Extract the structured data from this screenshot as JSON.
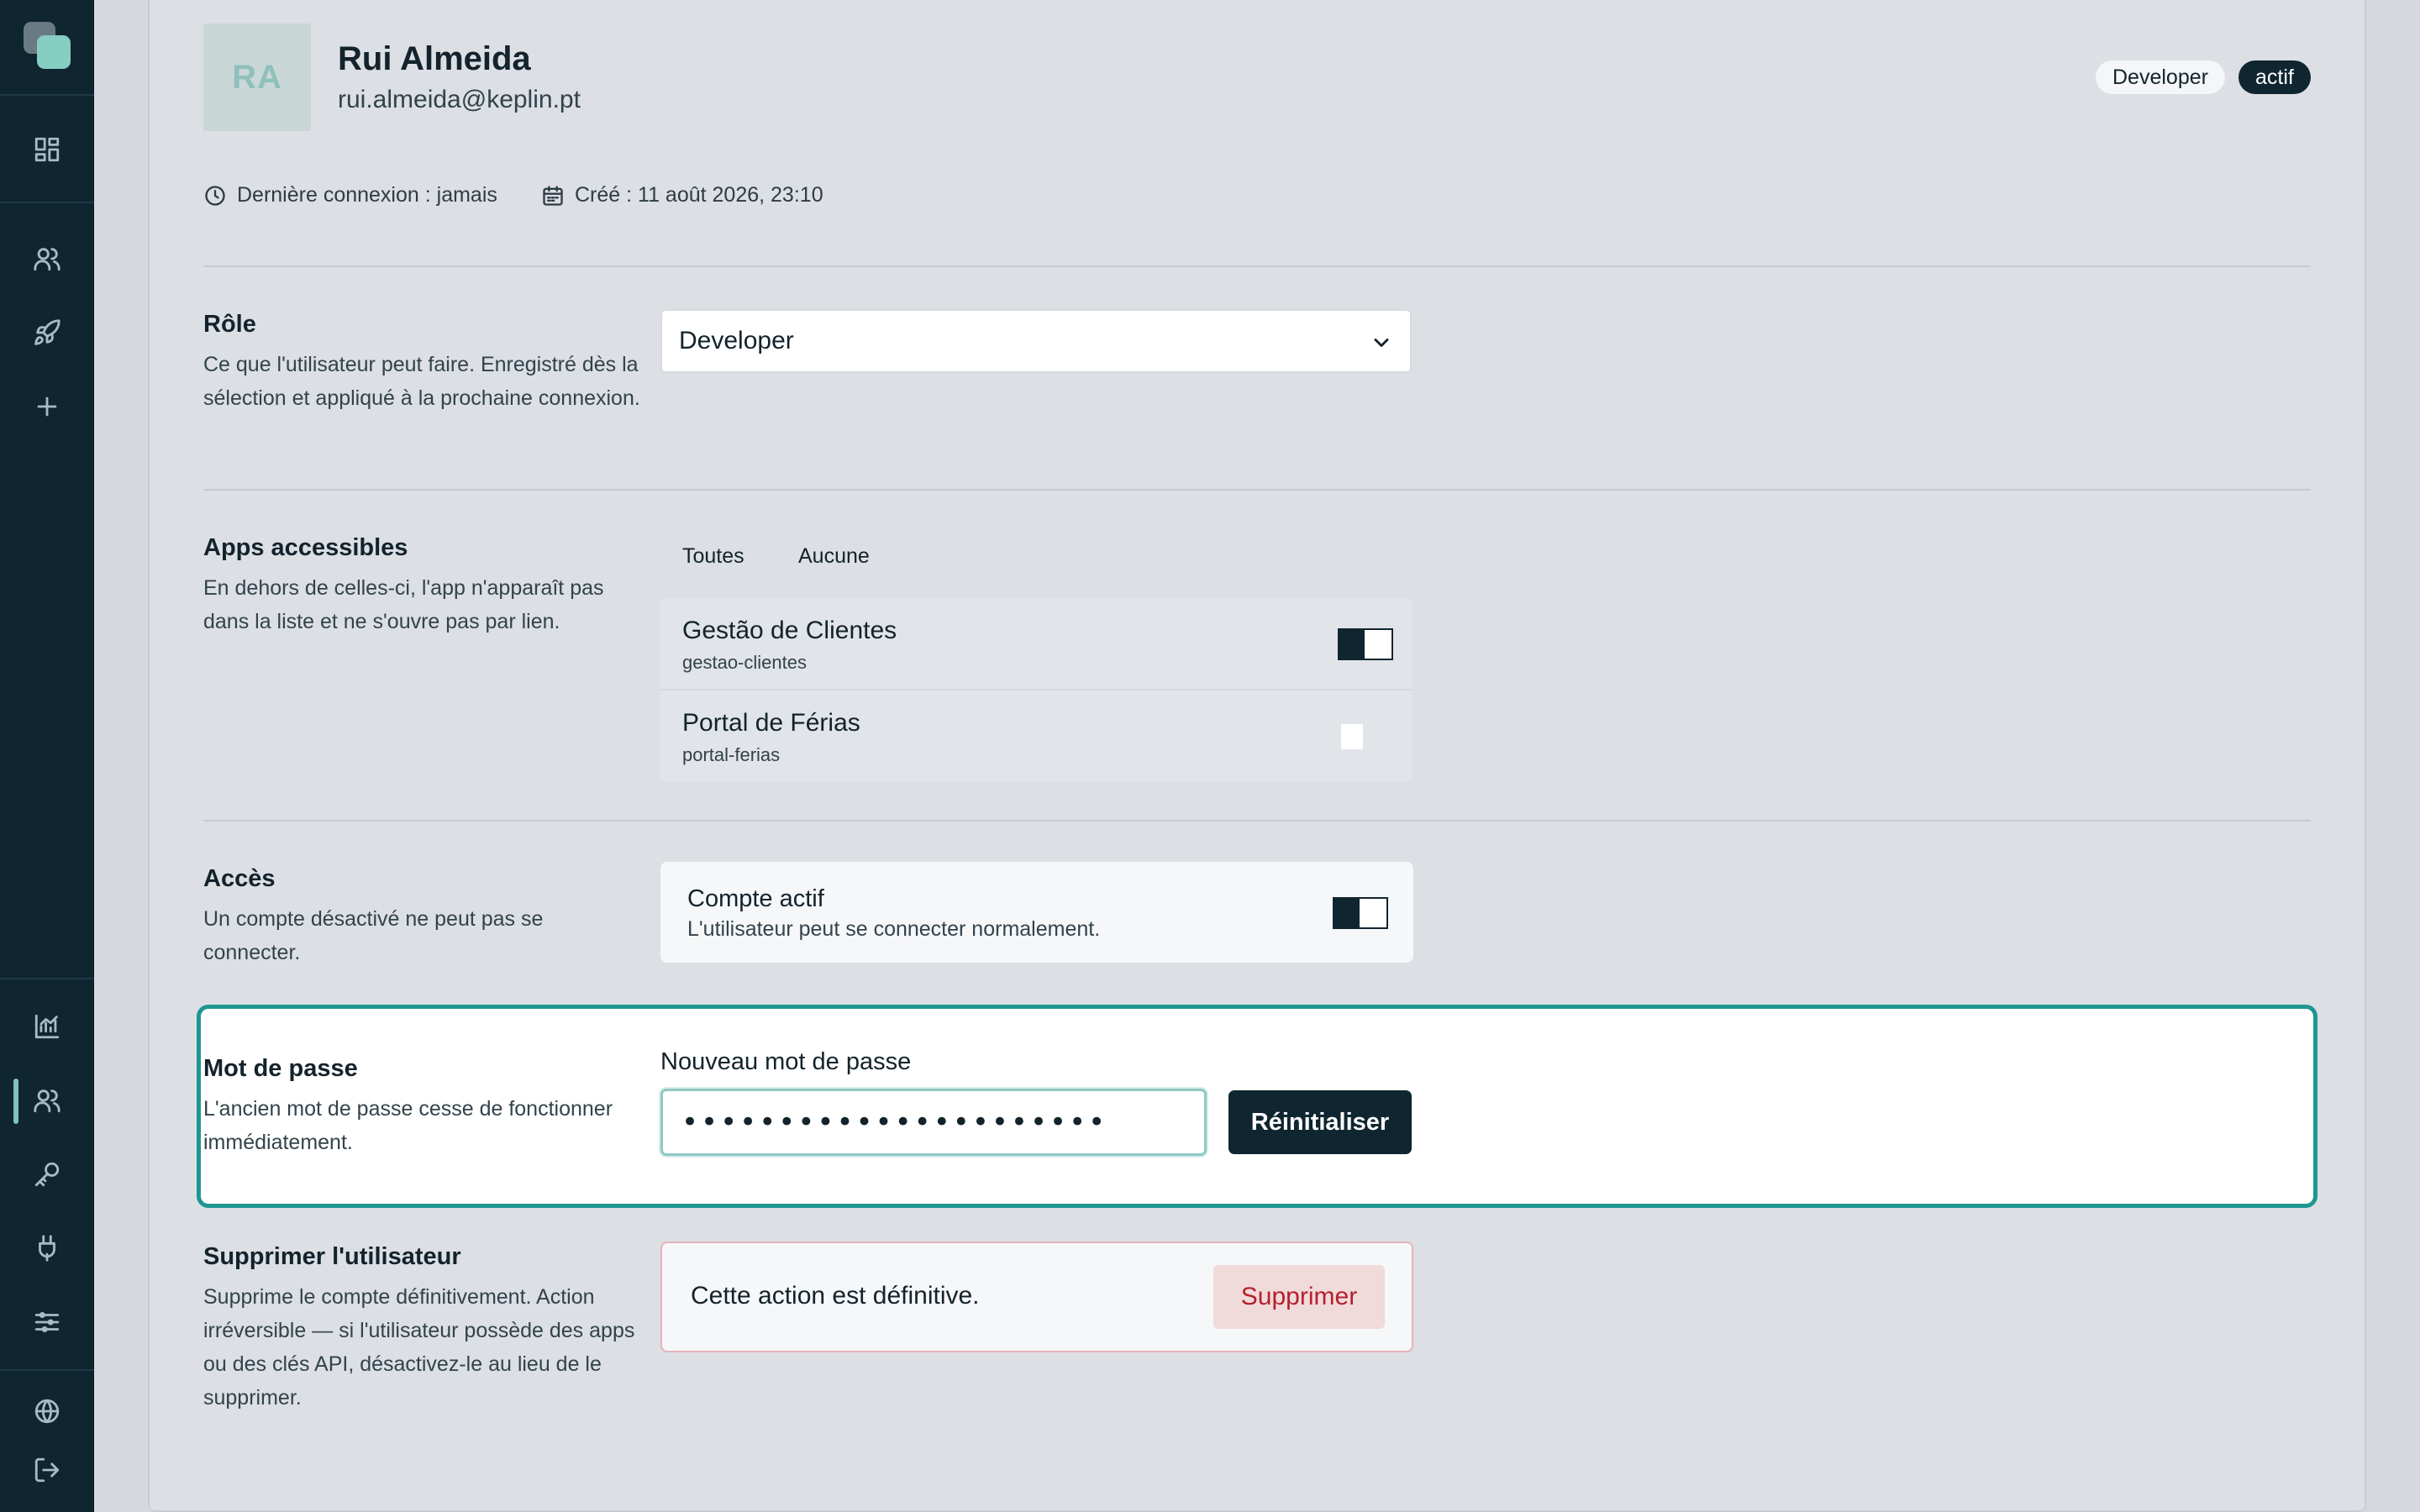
{
  "sidebar": {
    "icons": [
      "logo",
      "grid-icon",
      "users-icon",
      "rocket-icon",
      "plus-icon",
      "chart-icon",
      "users-icon",
      "key-icon",
      "plug-icon",
      "sliders-icon",
      "globe-icon",
      "logout-icon"
    ]
  },
  "user": {
    "initials": "RA",
    "name": "Rui Almeida",
    "email": "rui.almeida@keplin.pt",
    "role_badge": "Developer",
    "status_badge": "actif",
    "last_login": "Dernière connexion : jamais",
    "created": "Créé : 11 août 2026, 23:10"
  },
  "role_section": {
    "title": "Rôle",
    "description": "Ce que l'utilisateur peut faire. Enregistré dès la sélection et appliqué à la prochaine connexion.",
    "selected": "Developer"
  },
  "apps_section": {
    "title": "Apps accessibles",
    "description": "En dehors de celles-ci, l'app n'apparaît pas dans la liste et ne s'ouvre pas par lien.",
    "all_label": "Toutes",
    "none_label": "Aucune",
    "apps": [
      {
        "name": "Gestão de Clientes",
        "slug": "gestao-clientes",
        "enabled": true
      },
      {
        "name": "Portal de Férias",
        "slug": "portal-ferias",
        "enabled": false
      }
    ]
  },
  "access_section": {
    "title": "Accès",
    "description": "Un compte désactivé ne peut pas se connecter.",
    "toggle_title": "Compte actif",
    "toggle_desc": "L'utilisateur peut se connecter normalement.",
    "enabled": true
  },
  "password_section": {
    "title": "Mot de passe",
    "description": "L'ancien mot de passe cesse de fonctionner immédiatement.",
    "field_label": "Nouveau mot de passe",
    "value": "••••••••••••••••••••••",
    "button": "Réinitialiser"
  },
  "delete_section": {
    "title": "Supprimer l'utilisateur",
    "description": "Supprime le compte définitivement. Action irréversible — si l'utilisateur possède des apps ou des clés API, désactivez-le au lieu de le supprimer.",
    "warning": "Cette action est définitive.",
    "button": "Supprimer"
  },
  "colors": {
    "sidebar": "#0f2530",
    "accent": "#1f9690",
    "danger": "#b5202c"
  }
}
